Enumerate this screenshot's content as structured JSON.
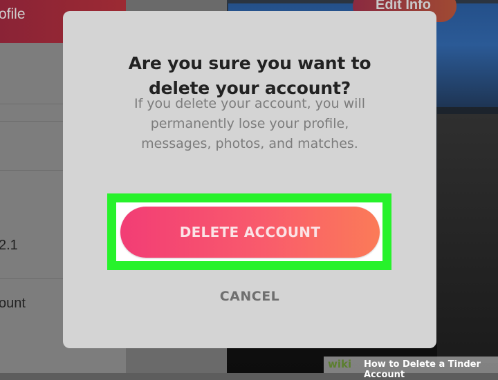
{
  "background": {
    "profile_tab_label": "ofile",
    "edit_info_label": "Edit Info",
    "rows": [
      "",
      "",
      "",
      "2.1",
      "ount"
    ]
  },
  "dialog": {
    "title_line1": "Are you sure you want to",
    "title_line2": "delete your account?",
    "message_line1": "If you delete your account, you will",
    "message_line2": "permanently lose your profile,",
    "message_line3": "messages, photos, and matches.",
    "delete_label": "DELETE ACCOUNT",
    "cancel_label": "CANCEL"
  },
  "watermark": {
    "logo": "wiki",
    "title": "How to Delete a Tinder Account"
  },
  "colors": {
    "highlight": "#27f22b",
    "button_start": "#f23d75",
    "button_end": "#fb7b58"
  }
}
